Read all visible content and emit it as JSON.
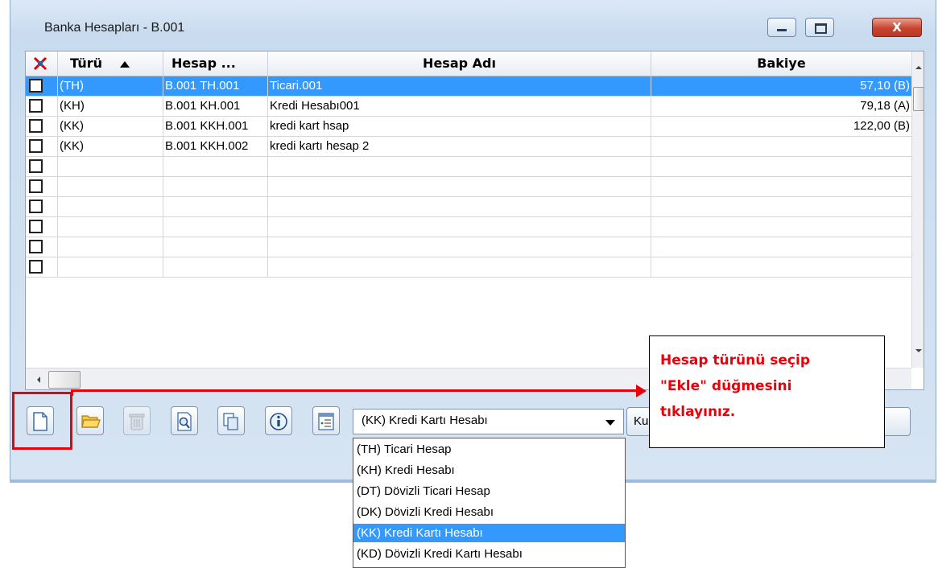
{
  "window": {
    "title": "Banka Hesapları - B.001",
    "close_label": "X"
  },
  "grid": {
    "columns": [
      "Türü",
      "Hesap ...",
      "Hesap Adı",
      "Bakiye"
    ],
    "rows": [
      {
        "turu": "(TH)",
        "kod": "B.001 TH.001",
        "ad": "Ticari.001",
        "bakiye": "57,10 (B)",
        "selected": true
      },
      {
        "turu": "(KH)",
        "kod": "B.001 KH.001",
        "ad": "Kredi Hesabı001",
        "bakiye": "79,18 (A)"
      },
      {
        "turu": "(KK)",
        "kod": "B.001 KKH.001",
        "ad": "kredi kart hsap",
        "bakiye": "122,00 (B)"
      },
      {
        "turu": "(KK)",
        "kod": "B.001 KKH.002",
        "ad": "kredi kartı hesap 2",
        "bakiye": ""
      },
      {
        "turu": "",
        "kod": "",
        "ad": "",
        "bakiye": ""
      },
      {
        "turu": "",
        "kod": "",
        "ad": "",
        "bakiye": ""
      },
      {
        "turu": "",
        "kod": "",
        "ad": "",
        "bakiye": ""
      },
      {
        "turu": "",
        "kod": "",
        "ad": "",
        "bakiye": ""
      },
      {
        "turu": "",
        "kod": "",
        "ad": "",
        "bakiye": ""
      },
      {
        "turu": "",
        "kod": "",
        "ad": "",
        "bakiye": ""
      }
    ]
  },
  "toolbar": {
    "buttons": [
      "new-icon",
      "open-folder-icon",
      "trash-icon",
      "preview-icon",
      "copy-icon",
      "info-icon",
      "list-icon"
    ],
    "account_type_value": "(KK) Kredi Kartı Hesabı",
    "partial_button_label": "Ku"
  },
  "dropdown": {
    "options": [
      "(TH) Ticari Hesap",
      "(KH) Kredi Hesabı",
      "(DT) Dövizli Ticari Hesap",
      "(DK) Dövizli Kredi Hesabı",
      "(KK) Kredi Kartı Hesabı",
      "(KD) Dövizli Kredi Kartı Hesabı"
    ],
    "selected_index": 4
  },
  "callout": {
    "line1": "Hesap türünü seçip",
    "line2": "\"Ekle\" düğmesini",
    "line3": "tıklayınız."
  },
  "colors": {
    "selection": "#3399ff",
    "annotation": "#e8000b"
  }
}
